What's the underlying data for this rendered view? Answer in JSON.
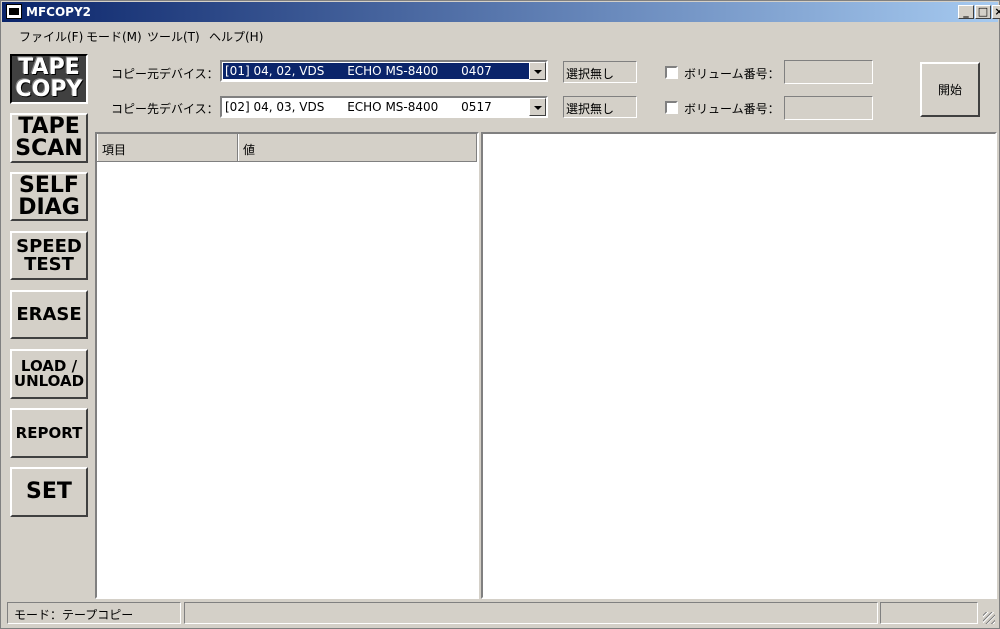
{
  "window": {
    "title": "MFCOPY2",
    "controls": {
      "minimize": "_",
      "maximize": "□",
      "close": "×"
    }
  },
  "menu": [
    {
      "label": "ファイル(F)"
    },
    {
      "label": "モード(M)"
    },
    {
      "label": "ツール(T)"
    },
    {
      "label": "ヘルプ(H)"
    }
  ],
  "sidebar": [
    {
      "label": "TAPE\nCOPY",
      "active": true
    },
    {
      "label": "TAPE\nSCAN"
    },
    {
      "label": "SELF\nDIAG"
    },
    {
      "label": "SPEED\nTEST"
    },
    {
      "label": "ERASE"
    },
    {
      "label": "LOAD /\nUNLOAD"
    },
    {
      "label": "REPORT"
    },
    {
      "label": "SET"
    }
  ],
  "source": {
    "label": "コピー元デバイス：",
    "device": "[01] 04, 02, VDS      ECHO MS-8400      0407",
    "status": "選択無し",
    "volume_label": "ボリューム番号：",
    "volume_value": ""
  },
  "dest": {
    "label": "コピー先デバイス：",
    "device": "[02] 04, 03, VDS      ECHO MS-8400      0517",
    "status": "選択無し",
    "volume_label": "ボリューム番号：",
    "volume_value": ""
  },
  "start_button": "開始",
  "list": {
    "columns": [
      "項目",
      "値"
    ]
  },
  "statusbar": {
    "mode": "モード：テープコピー"
  }
}
